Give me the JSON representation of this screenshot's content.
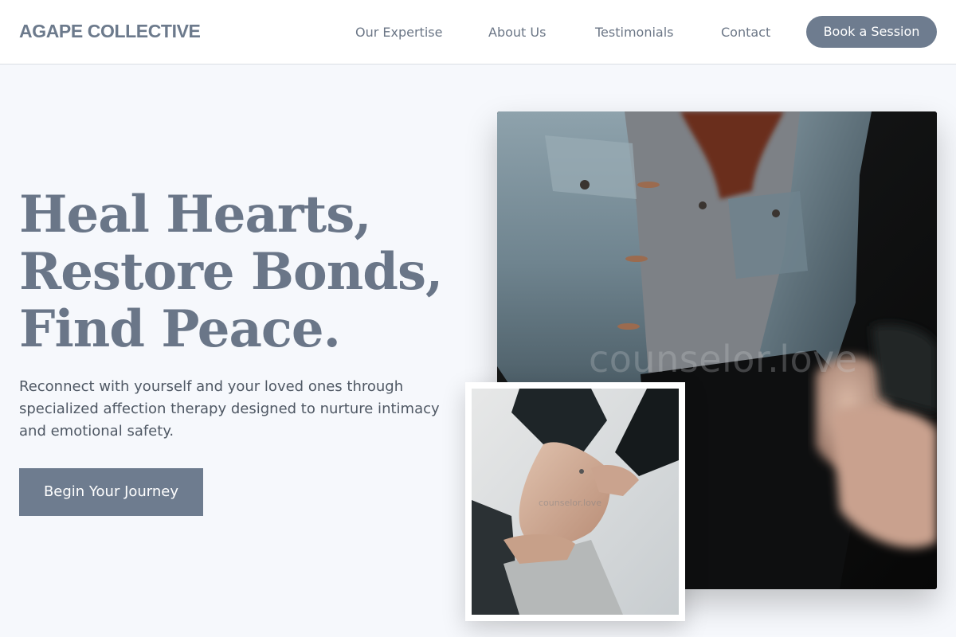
{
  "header": {
    "logo": "AGAPE COLLECTIVE",
    "nav": [
      "Our Expertise",
      "About Us",
      "Testimonials",
      "Contact"
    ],
    "cta_label": "Book a Session"
  },
  "hero": {
    "headline_lines": [
      "Heal Hearts,",
      "Restore Bonds,",
      "Find Peace."
    ],
    "subtext": "Reconnect with yourself and your loved ones through specialized affection therapy designed to nurture intimacy and emotional safety.",
    "cta_label": "Begin Your Journey"
  },
  "images": {
    "main_watermark": "counselor.love",
    "secondary_watermark": "counselor.love"
  },
  "colors": {
    "accent": "#6e7c8f",
    "heading": "#6a7688",
    "background": "#f6f8fc",
    "body_text": "#4f5864"
  }
}
